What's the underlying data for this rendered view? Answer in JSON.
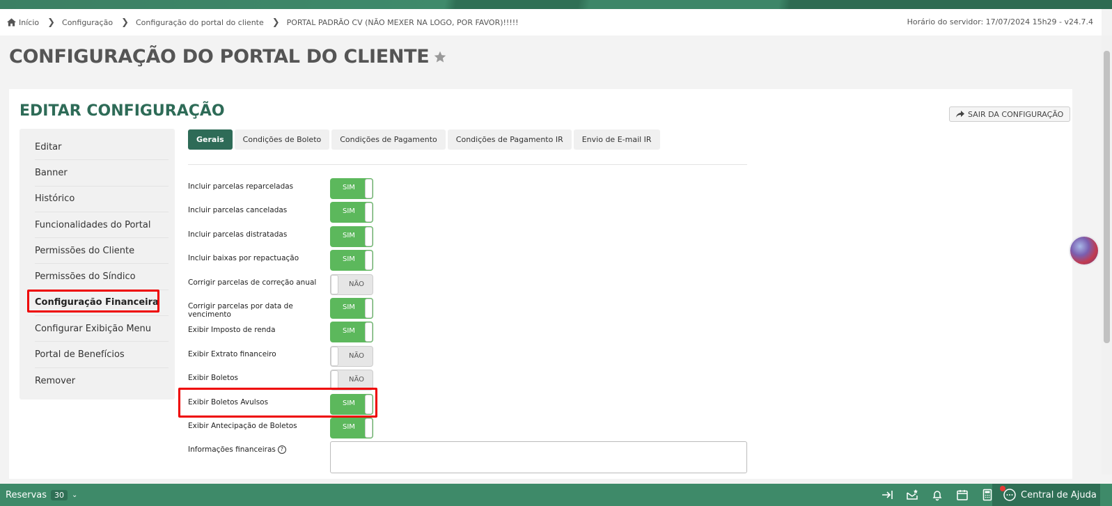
{
  "breadcrumb": {
    "items": [
      "Início",
      "Configuração",
      "Configuração do portal do cliente",
      "PORTAL PADRÃO CV (NÃO MEXER NA LOGO, POR FAVOR)!!!!!"
    ],
    "server_time": "Horário do servidor: 17/07/2024 15h29 - v24.7.4"
  },
  "page": {
    "title": "CONFIGURAÇÃO DO PORTAL DO CLIENTE"
  },
  "card": {
    "title": "EDITAR CONFIGURAÇÃO",
    "exit_label": "SAIR DA CONFIGURAÇÃO"
  },
  "sidebar": {
    "items": [
      {
        "label": "Editar"
      },
      {
        "label": "Banner"
      },
      {
        "label": "Histórico"
      },
      {
        "label": "Funcionalidades do Portal"
      },
      {
        "label": "Permissões do Cliente"
      },
      {
        "label": "Permissões do Síndico"
      },
      {
        "label": "Configuração Financeira"
      },
      {
        "label": "Configurar Exibição Menu"
      },
      {
        "label": "Portal de Benefícios"
      },
      {
        "label": "Remover"
      }
    ],
    "active_index": 6
  },
  "tabs": [
    {
      "label": "Gerais",
      "active": true
    },
    {
      "label": "Condições de Boleto"
    },
    {
      "label": "Condições de Pagamento"
    },
    {
      "label": "Condições de Pagamento IR"
    },
    {
      "label": "Envio de E-mail IR"
    }
  ],
  "settings": [
    {
      "label": "Incluir parcelas reparceladas",
      "value": "SIM"
    },
    {
      "label": "Incluir parcelas canceladas",
      "value": "SIM"
    },
    {
      "label": "Incluir parcelas distratadas",
      "value": "SIM"
    },
    {
      "label": "Incluir baixas por repactuação",
      "value": "SIM"
    },
    {
      "label": "Corrigir parcelas de correção anual",
      "value": "NÃO"
    },
    {
      "label": "Corrigir parcelas por data de vencimento",
      "value": "SIM"
    },
    {
      "label": "Exibir Imposto de renda",
      "value": "SIM"
    },
    {
      "label": "Exibir Extrato financeiro",
      "value": "NÃO"
    },
    {
      "label": "Exibir Boletos",
      "value": "NÃO"
    },
    {
      "label": "Exibir Boletos Avulsos",
      "value": "SIM"
    },
    {
      "label": "Exibir Antecipação de Boletos",
      "value": "SIM"
    }
  ],
  "financial_info": {
    "label": "Informações financeiras",
    "help": "?"
  },
  "bottombar": {
    "reservas_label": "Reservas",
    "reservas_count": "30",
    "help_label": "Central de Ajuda"
  },
  "colors": {
    "brand_green": "#2e6b57",
    "toggle_on": "#5cb85c",
    "bar_green": "#3e8a69",
    "highlight": "#e00000"
  }
}
